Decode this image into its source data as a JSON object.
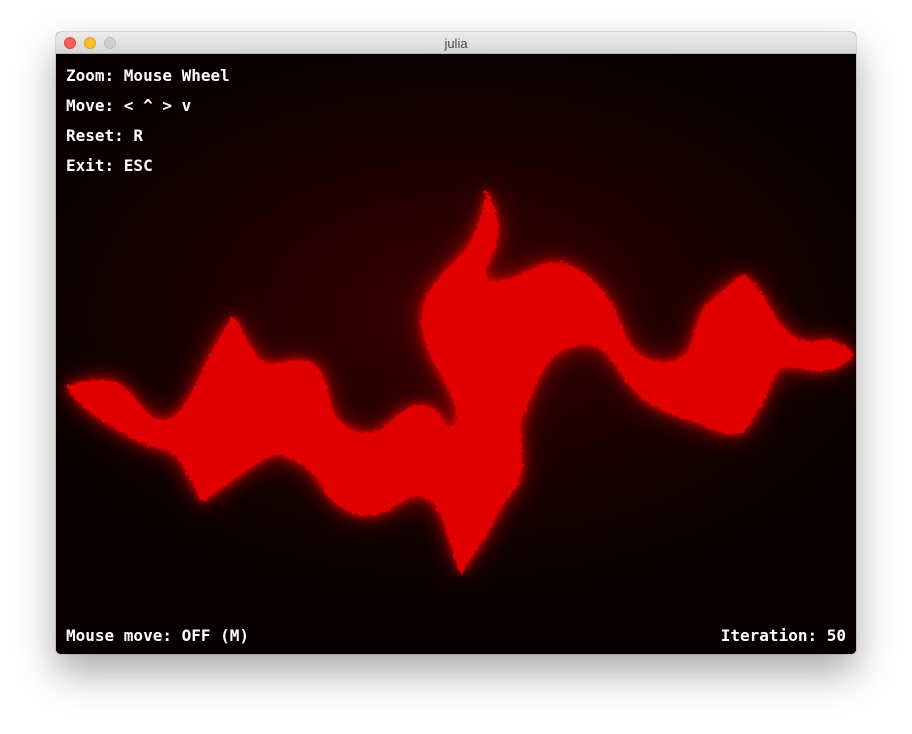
{
  "window": {
    "title": "julia"
  },
  "hints": {
    "zoom": "Zoom: Mouse Wheel",
    "move": "Move: < ^ > v",
    "reset": "Reset: R",
    "exit": "Exit: ESC"
  },
  "status": {
    "mouse_move": "Mouse move: OFF (M)",
    "iteration_label": "Iteration:",
    "iteration_value": "50"
  },
  "colors": {
    "fractal_glow": "#ff0000",
    "fractal_core": "#000000",
    "background": "#0d0000"
  }
}
